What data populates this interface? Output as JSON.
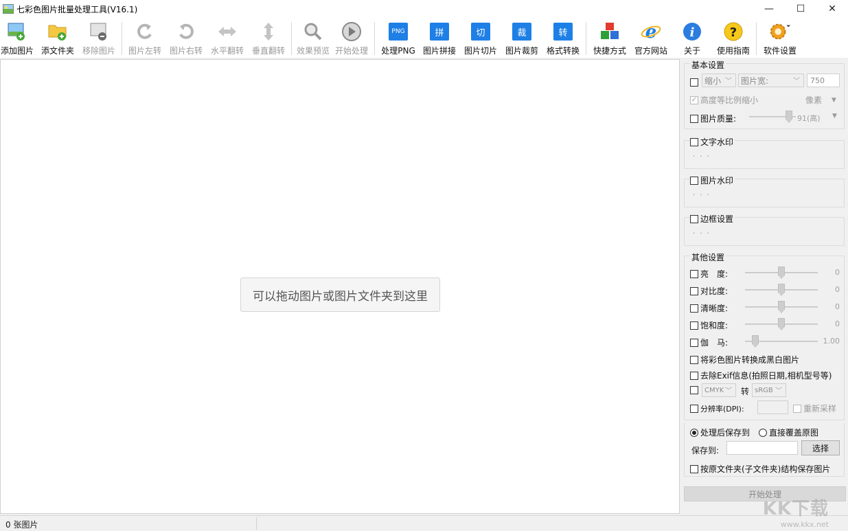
{
  "window": {
    "title": "七彩色图片批量处理工具(V16.1)",
    "minimize_icon": "minimize-icon",
    "maximize_icon": "maximize-icon",
    "close_icon": "close-icon"
  },
  "toolbar": {
    "add_image": "添加图片",
    "add_folder": "添文件夹",
    "remove_image": "移除图片",
    "rotate_left": "图片左转",
    "rotate_right": "图片右转",
    "flip_h": "水平翻转",
    "flip_v": "垂直翻转",
    "preview": "效果预览",
    "start": "开始处理",
    "png": "处理PNG",
    "png_badge": "PNG",
    "stitch": "图片拼接",
    "stitch_badge": "拼",
    "slice": "图片切片",
    "slice_badge": "切",
    "crop": "图片裁剪",
    "crop_badge": "裁",
    "convert": "格式转换",
    "convert_badge": "转",
    "shortcut": "快捷方式",
    "website": "官方网站",
    "about": "关于",
    "guide": "使用指南",
    "settings": "软件设置"
  },
  "drop": {
    "hint": "可以拖动图片或图片文件夹到这里"
  },
  "basic": {
    "title": "基本设置",
    "mode": "缩小",
    "dimension": "图片宽:",
    "size_value": "750",
    "keep_ratio": "高度等比例缩小",
    "unit": "像素",
    "quality_label": "图片质量:",
    "quality_value": "91(高)",
    "quality_level": 0.91
  },
  "text_watermark": {
    "label": "文字水印",
    "dots": "· · ·"
  },
  "image_watermark": {
    "label": "图片水印",
    "dots": "· · ·"
  },
  "border": {
    "label": "边框设置",
    "dots": "· · ·"
  },
  "other": {
    "title": "其他设置",
    "brightness": "亮　度:",
    "brightness_value": "0",
    "contrast": "对比度:",
    "contrast_value": "0",
    "sharpness": "清晰度:",
    "sharpness_value": "0",
    "saturation": "饱和度:",
    "saturation_value": "0",
    "gamma": "伽　马:",
    "gamma_value": "1.00",
    "grayscale": "将彩色图片转换成黑白图片",
    "remove_exif": "去除Exif信息(拍照日期,相机型号等)",
    "color_from": "CMYK",
    "to_label": "转",
    "color_to": "sRGB",
    "dpi_label": "分辨率(DPI):",
    "resample": "重新采样"
  },
  "save": {
    "save_to_radio": "处理后保存到",
    "overwrite_radio": "直接覆盖原图",
    "save_to_label": "保存到:",
    "path_value": "",
    "browse": "选择",
    "keep_structure": "按原文件夹(子文件夹)结构保存图片",
    "start": "开始处理"
  },
  "status": {
    "text": "0 张图片"
  },
  "watermark": {
    "brand": "KK下载",
    "url": "www.kkx.net"
  }
}
